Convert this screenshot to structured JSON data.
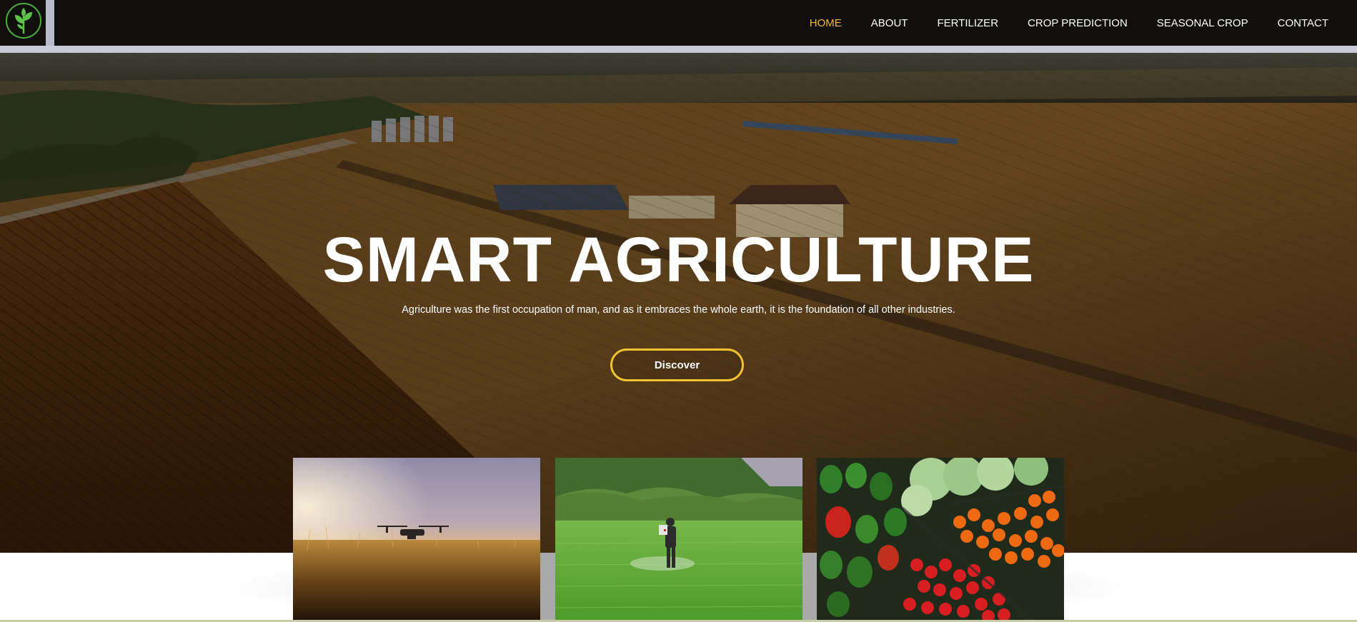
{
  "nav": {
    "items": [
      {
        "label": "HOME",
        "active": true
      },
      {
        "label": "ABOUT",
        "active": false
      },
      {
        "label": "FERTILIZER",
        "active": false
      },
      {
        "label": "CROP PREDICTION",
        "active": false
      },
      {
        "label": "SEASONAL CROP",
        "active": false
      },
      {
        "label": "CONTACT",
        "active": false
      }
    ]
  },
  "hero": {
    "title": "SMART AGRICULTURE",
    "subtitle": "Agriculture was the first occupation of man, and as it embraces the whole earth, it is the foundation of all other industries.",
    "button_label": "Discover"
  },
  "colors": {
    "accent": "#f2b92c",
    "button_border": "#f2c230",
    "nav_bg": "#100f0c"
  },
  "icons": {
    "logo": "plant-sprout-icon"
  }
}
